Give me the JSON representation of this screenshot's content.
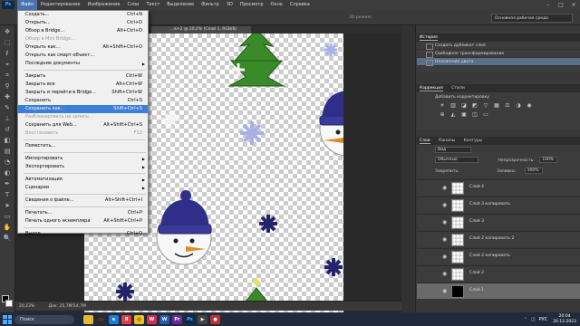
{
  "app": {
    "logo": "Ps"
  },
  "menubar": {
    "items": [
      "Файл",
      "Редактирование",
      "Изображение",
      "Слои",
      "Текст",
      "Выделение",
      "Фильтр",
      "3D",
      "Просмотр",
      "Окно",
      "Справка"
    ],
    "active_index": 0
  },
  "options_bar": {
    "workspace": "Основная рабочая среда",
    "mode3d": "3D-режим:"
  },
  "document": {
    "tab_title": "...лл-2 @ 20,2% (Слой 1, RGB/8)",
    "zoom": "20,23%",
    "doc_info": "Док: 25,7M/14,7M"
  },
  "file_menu": {
    "groups": [
      [
        {
          "label": "Создать...",
          "shortcut": "Ctrl+N"
        },
        {
          "label": "Открыть...",
          "shortcut": "Ctrl+O"
        },
        {
          "label": "Обзор в Bridge...",
          "shortcut": "Alt+Ctrl+O"
        },
        {
          "label": "Обзор в Mini Bridge...",
          "shortcut": "",
          "disabled": true
        },
        {
          "label": "Открыть как...",
          "shortcut": "Alt+Shift+Ctrl+O"
        },
        {
          "label": "Открыть как смарт-объект...",
          "shortcut": ""
        },
        {
          "label": "Последние документы",
          "shortcut": "",
          "submenu": true
        }
      ],
      [
        {
          "label": "Закрыть",
          "shortcut": "Ctrl+W"
        },
        {
          "label": "Закрыть все",
          "shortcut": "Alt+Ctrl+W"
        },
        {
          "label": "Закрыть и перейти в Bridge...",
          "shortcut": "Shift+Ctrl+W"
        },
        {
          "label": "Сохранить",
          "shortcut": "Ctrl+S"
        },
        {
          "label": "Сохранить как...",
          "shortcut": "Shift+Ctrl+S",
          "highlighted": true
        },
        {
          "label": "Разблокировать на запись...",
          "shortcut": "",
          "disabled": true
        },
        {
          "label": "Сохранить для Web...",
          "shortcut": "Alt+Shift+Ctrl+S"
        },
        {
          "label": "Восстановить",
          "shortcut": "F12",
          "disabled": true
        }
      ],
      [
        {
          "label": "Поместить...",
          "shortcut": ""
        }
      ],
      [
        {
          "label": "Импортировать",
          "shortcut": "",
          "submenu": true
        },
        {
          "label": "Экспортировать",
          "shortcut": "",
          "submenu": true
        }
      ],
      [
        {
          "label": "Автоматизация",
          "shortcut": "",
          "submenu": true
        },
        {
          "label": "Сценарии",
          "shortcut": "",
          "submenu": true
        }
      ],
      [
        {
          "label": "Сведения о файле...",
          "shortcut": "Alt+Shift+Ctrl+I"
        }
      ],
      [
        {
          "label": "Печатать...",
          "shortcut": "Ctrl+P"
        },
        {
          "label": "Печать одного экземпляра",
          "shortcut": "Alt+Shift+Ctrl+P"
        }
      ],
      [
        {
          "label": "Выход",
          "shortcut": "Ctrl+Q"
        }
      ]
    ]
  },
  "history": {
    "title": "История",
    "items": [
      {
        "label": "Создать дубликат слоя"
      },
      {
        "label": "Свободное трансформирование"
      },
      {
        "label": "Наложение цвета",
        "selected": true
      }
    ]
  },
  "corrections": {
    "tabs": [
      "Коррекция",
      "Стили"
    ],
    "label": "Добавить корректировку"
  },
  "layers_panel": {
    "tabs": [
      "Слои",
      "Каналы",
      "Контуры"
    ],
    "filter": "Вид",
    "blend_mode": "Обычные",
    "opacity_label": "Непрозрачность:",
    "opacity": "100%",
    "lock_label": "Закрепить:",
    "fill_label": "Заливка:",
    "fill": "100%",
    "layers": [
      {
        "name": "Слой 4"
      },
      {
        "name": "Слой 3 копировать"
      },
      {
        "name": "Слой 3"
      },
      {
        "name": "Слой 2 копировать 2"
      },
      {
        "name": "Слой 2 копировать"
      },
      {
        "name": "Слой 2"
      },
      {
        "name": "Слой 1",
        "selected": true
      }
    ]
  },
  "taskbar": {
    "search_placeholder": "Поиск",
    "lang": "РУС",
    "time": "20:04",
    "date": "20.12.2023"
  },
  "colors": {
    "accent": "#3d7ed6",
    "menubar": "#3c3c3c",
    "panel": "#383838",
    "hat": "#2f2f8a",
    "flake_dark": "#23246b",
    "flake_light": "#a8b0e8",
    "tree": "#3a8a2a",
    "carrot": "#e08a2a"
  }
}
